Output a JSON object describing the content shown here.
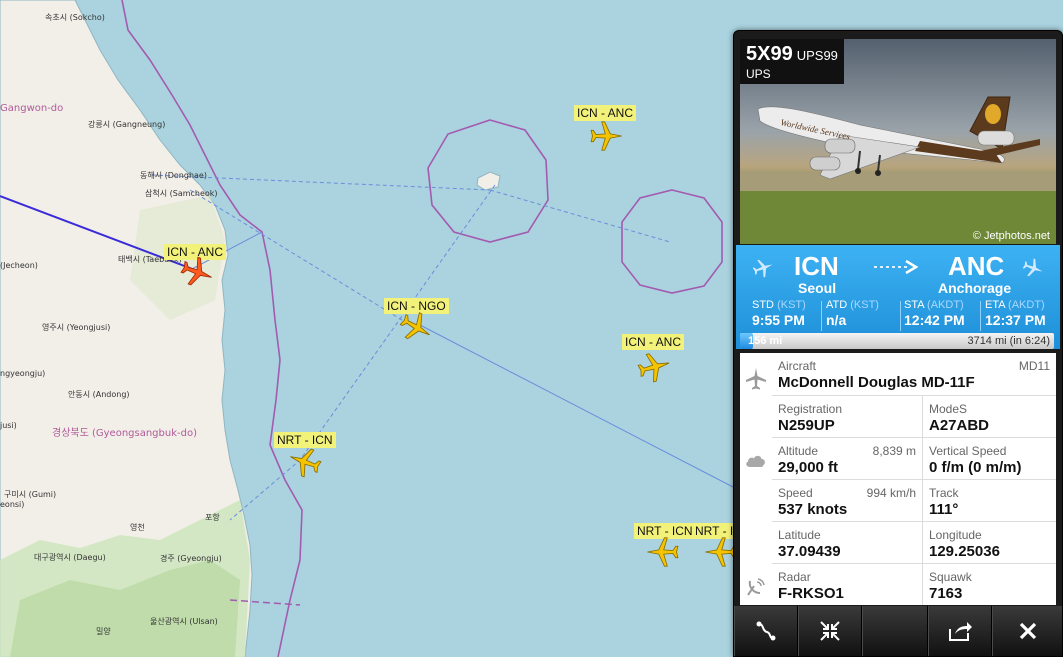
{
  "map": {
    "places": [
      {
        "name": "속초시 (Sokcho)"
      },
      {
        "name": "Gangwon-do"
      },
      {
        "name": "강릉시 (Gangneung)"
      },
      {
        "name": "동해시 (Donghae)"
      },
      {
        "name": "삼척시 (Samcheok)"
      },
      {
        "name": "태백시 (Taebaek)"
      },
      {
        "name": "(Jecheon)"
      },
      {
        "name": "영주시 (Yeongjusi)"
      },
      {
        "name": "ngyeongju)"
      },
      {
        "name": "안동시 (Andong)"
      },
      {
        "name": "경상북도 (Gyeongsangbuk-do)"
      },
      {
        "name": "jusi)"
      },
      {
        "name": "구미시 (Gumi)"
      },
      {
        "name": "eonsi)"
      },
      {
        "name": "영천"
      },
      {
        "name": "포항"
      },
      {
        "name": "대구광역시 (Daegu)"
      },
      {
        "name": "경주 (Gyeongju)"
      },
      {
        "name": "울산광역시 (Ulsan)"
      },
      {
        "name": "밀양"
      }
    ],
    "flights": [
      {
        "route": "ICN - ANC",
        "selected": true
      },
      {
        "route": "ICN - ANC",
        "selected": false
      },
      {
        "route": "ICN - NGO",
        "selected": false
      },
      {
        "route": "ICN - ANC",
        "selected": false
      },
      {
        "route": "NRT - ICN",
        "selected": false
      },
      {
        "route": "NRT - ICN",
        "selected": false
      },
      {
        "route": "NRT - I",
        "selected": false
      }
    ],
    "colors": {
      "sea": "#aad3df",
      "land": "#f2efe9",
      "selected_track": "#3a2bd8",
      "plane": "#f5c400",
      "selected_plane": "#ff5a1f",
      "fir_boundary": "#a35bb0"
    }
  },
  "panel": {
    "callsign": "5X99",
    "callsign_alt": "UPS99",
    "airline": "UPS",
    "photo_credit": "© Jetphotos.net",
    "photo_caption": "Worldwide Services",
    "origin": {
      "code": "ICN",
      "city": "Seoul"
    },
    "destination": {
      "code": "ANC",
      "city": "Anchorage"
    },
    "times": [
      {
        "label": "STD",
        "tz": "(KST)",
        "value": "9:55 PM"
      },
      {
        "label": "ATD",
        "tz": "(KST)",
        "value": "n/a"
      },
      {
        "label": "STA",
        "tz": "(AKDT)",
        "value": "12:42 PM"
      },
      {
        "label": "ETA",
        "tz": "(AKDT)",
        "value": "12:37 PM"
      }
    ],
    "progress": {
      "flown": "156 mi",
      "remaining": "3714 mi (in 6:24)",
      "fraction": 0.04
    },
    "details": {
      "aircraft_label": "Aircraft",
      "aircraft_code": "MD11",
      "aircraft_value": "McDonnell Douglas MD-11F",
      "registration_label": "Registration",
      "registration_value": "N259UP",
      "modes_label": "ModeS",
      "modes_value": "A27ABD",
      "altitude_label": "Altitude",
      "altitude_metric": "8,839 m",
      "altitude_value": "29,000 ft",
      "vspeed_label": "Vertical Speed",
      "vspeed_value": "0 f/m (0 m/m)",
      "speed_label": "Speed",
      "speed_metric": "994 km/h",
      "speed_value": "537 knots",
      "track_label": "Track",
      "track_value": "111°",
      "lat_label": "Latitude",
      "lat_value": "37.09439",
      "lon_label": "Longitude",
      "lon_value": "129.25036",
      "radar_label": "Radar",
      "radar_value": "F-RKSO1",
      "squawk_label": "Squawk",
      "squawk_value": "7163"
    },
    "toolbar": [
      "route-icon",
      "collapse-icon",
      "blank",
      "share-icon",
      "close-icon"
    ]
  }
}
